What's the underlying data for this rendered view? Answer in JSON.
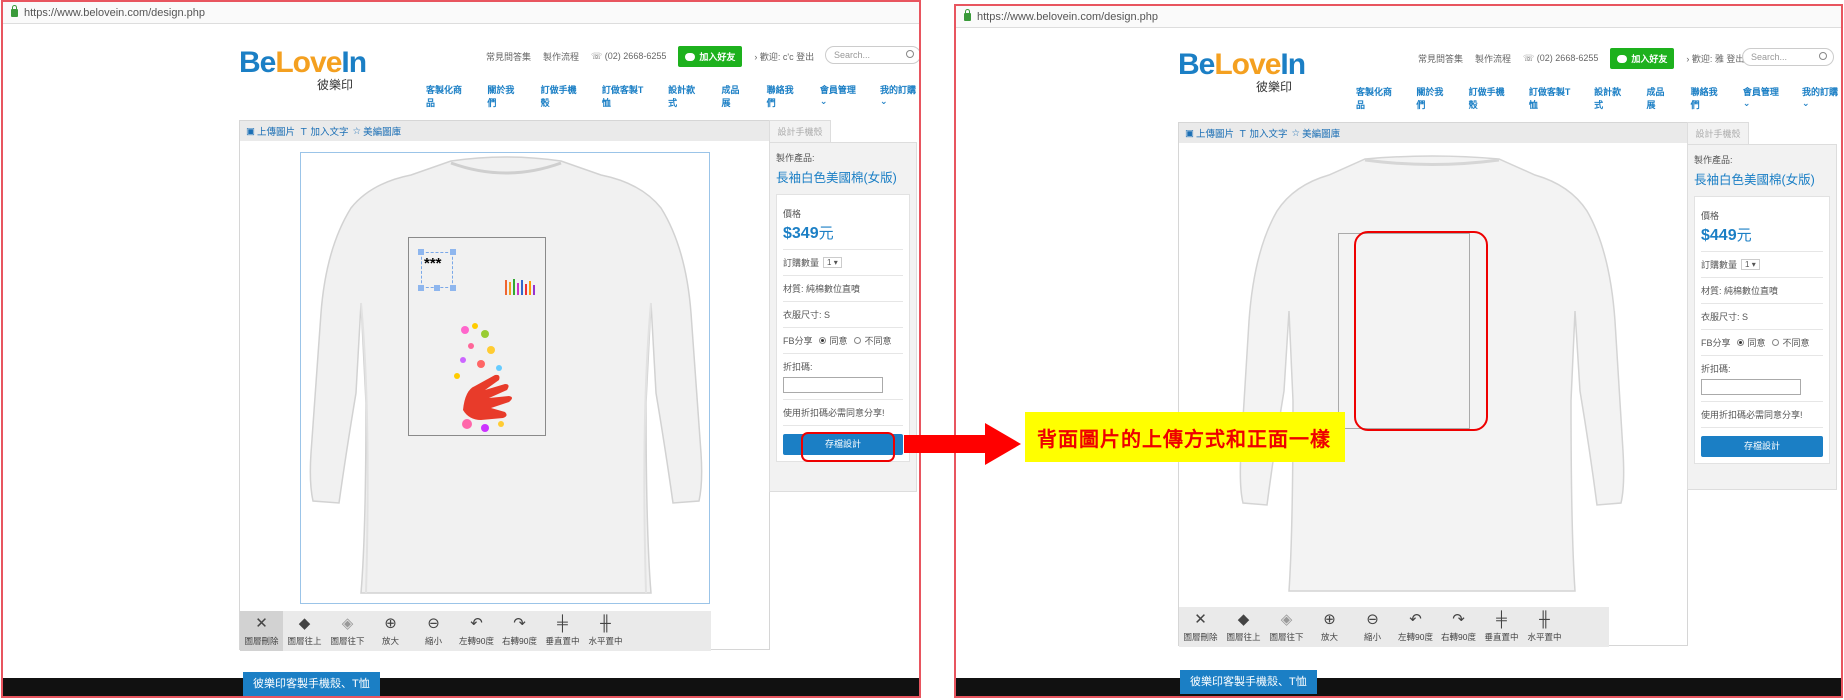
{
  "browser": {
    "url_left": "https://www.belovein.com/design.php",
    "url_right": "https://www.belovein.com/design.php"
  },
  "logo": {
    "part1": "Be",
    "part2": "Love",
    "part3": "In",
    "sub": "彼樂印"
  },
  "header": {
    "faq": "常見問答集",
    "process": "製作流程",
    "phone": "(02) 2668-6255",
    "line_add": "加入好友",
    "welcome_left": "歡迎: c'c",
    "welcome_right": "歡迎: 雅",
    "logout": "登出",
    "search_placeholder": "Search..."
  },
  "nav": [
    "客製化商品",
    "關於我們",
    "訂做手機殼",
    "訂做客製T恤",
    "設計款式",
    "成品展",
    "聯絡我們",
    "會員管理",
    "我的訂購"
  ],
  "editor_toolbar": {
    "upload": "上傳圖片",
    "add_text": "加入文字",
    "clipart": "美編圖庫"
  },
  "canvas": {
    "text_element": "***"
  },
  "sidebar": {
    "tab": "設計手機殼",
    "product_label": "製作產品:",
    "product_name": "長袖白色美國棉(女版)",
    "price_label": "價格",
    "price_left": "$349",
    "price_right": "$449",
    "price_unit": "元",
    "qty_label": "訂購數量",
    "qty_value": "1",
    "material": "材質: 純棉數位直噴",
    "size": "衣服尺寸: S",
    "fb_label": "FB分享",
    "fb_yes": "同意",
    "fb_no": "不同意",
    "coupon_label": "折扣碼:",
    "coupon_note": "使用折扣碼必需同意分享!",
    "save": "存檔設計"
  },
  "bottom_tools": [
    {
      "icon": "close-icon",
      "label": "圖層刪除"
    },
    {
      "icon": "layer-up-icon",
      "label": "圖層往上"
    },
    {
      "icon": "layer-down-icon",
      "label": "圖層往下"
    },
    {
      "icon": "zoom-in-icon",
      "label": "放大"
    },
    {
      "icon": "zoom-out-icon",
      "label": "縮小"
    },
    {
      "icon": "rotate-left-icon",
      "label": "左轉90度"
    },
    {
      "icon": "rotate-right-icon",
      "label": "右轉90度"
    },
    {
      "icon": "vcenter-icon",
      "label": "垂直置中"
    },
    {
      "icon": "hcenter-icon",
      "label": "水平置中"
    }
  ],
  "footer_tag": "彼樂印客製手機殼、T恤",
  "annotation": {
    "text": "背面圖片的上傳方式和正面一樣",
    "arrow_color": "#ff0000",
    "box_color": "#ffff00"
  },
  "colors": {
    "brand_blue": "#1b7fc5",
    "brand_orange": "#f4a020",
    "line_green": "#1db11d",
    "highlight_red": "#e00000"
  }
}
